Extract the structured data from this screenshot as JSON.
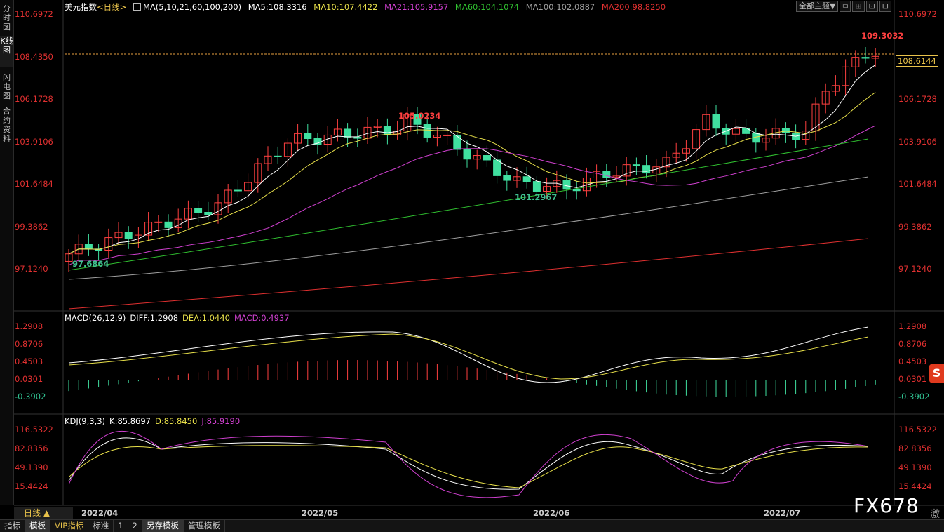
{
  "sidebar": {
    "tabs": [
      {
        "label": "分时图",
        "active": false
      },
      {
        "label": "K线图",
        "active": true
      },
      {
        "label": "闪电图",
        "active": false
      },
      {
        "label": "合约资料",
        "active": false
      }
    ]
  },
  "main_chart": {
    "instrument": "美元指数",
    "period_tag": "<日线>",
    "ma_label": "MA(5,10,21,60,100,200)",
    "ma_values": [
      {
        "text": "MA5:108.3316",
        "color": "#ffffff"
      },
      {
        "text": "MA10:107.4422",
        "color": "#e8e04a"
      },
      {
        "text": "MA21:105.9157",
        "color": "#d040d0"
      },
      {
        "text": "MA60:104.1074",
        "color": "#30c030"
      },
      {
        "text": "MA100:102.0887",
        "color": "#a0a0a0"
      },
      {
        "text": "MA200:98.8250",
        "color": "#e03030"
      }
    ],
    "y_ticks": [
      "110.6972",
      "108.4350",
      "106.1728",
      "103.9106",
      "101.6484",
      "99.3862",
      "97.1240"
    ],
    "current_price": "108.6144",
    "annotations": {
      "high": "109.3032",
      "mid_high": "105.0234",
      "mid_low": "101.2967",
      "low": "97.6864"
    }
  },
  "macd_panel": {
    "label": "MACD(26,12,9)",
    "diff": "DIFF:1.2908",
    "dea": "DEA:1.0440",
    "macd": "MACD:0.4937",
    "y_ticks": [
      "1.2908",
      "0.8706",
      "0.4503",
      "0.0301",
      "-0.3902"
    ]
  },
  "kdj_panel": {
    "label": "KDJ(9,3,3)",
    "k": "K:85.8697",
    "d": "D:85.8450",
    "j": "J:85.9190",
    "y_ticks": [
      "116.5322",
      "82.8356",
      "49.1390",
      "15.4424"
    ]
  },
  "toolbar": {
    "theme_label": "全部主题▼"
  },
  "date_axis": [
    "2022/04",
    "2022/05",
    "2022/06",
    "2022/07"
  ],
  "period_button": "日线 ▲",
  "bottom_tabs": [
    {
      "label": "指标",
      "active": false
    },
    {
      "label": "模板",
      "active": true
    },
    {
      "label": "VIP指标",
      "active": false,
      "vip": true
    },
    {
      "label": "标准",
      "active": false
    },
    {
      "label": "1",
      "active": false
    },
    {
      "label": "2",
      "active": false
    },
    {
      "label": "另存模板",
      "active": true
    },
    {
      "label": "管理模板",
      "active": false
    }
  ],
  "watermark": "FX678",
  "watermark_extra": "激"
}
